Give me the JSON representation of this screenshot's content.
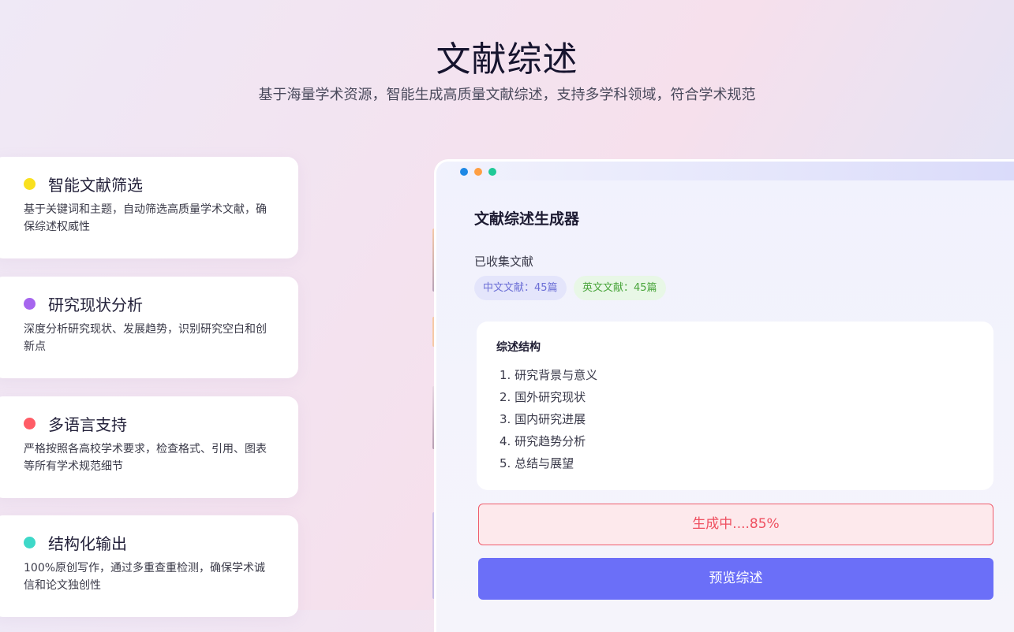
{
  "hero": {
    "title": "文献综述",
    "subtitle": "基于海量学术资源，智能生成高质量文献综述，支持多学科领域，符合学术规范"
  },
  "features": [
    {
      "title": "智能文献筛选",
      "desc": "基于关键词和主题，自动筛选高质量学术文献，确保综述权威性",
      "color": "#f9e01f"
    },
    {
      "title": "研究现状分析",
      "desc": "深度分析研究现状、发展趋势，识别研究空白和创新点",
      "color": "#a666ee"
    },
    {
      "title": "多语言支持",
      "desc": "严格按照各高校学术要求，检查格式、引用、图表等所有学术规范细节",
      "color": "#ff5c66"
    },
    {
      "title": "结构化输出",
      "desc": "100%原创写作，通过多重查重检测，确保学术诚信和论文独创性",
      "color": "#3ed8c8"
    }
  ],
  "app": {
    "title": "文献综述生成器",
    "collected_label": "已收集文献",
    "tags": {
      "chinese": "中文文献：45篇",
      "english": "英文文献：45篇"
    },
    "outline": {
      "title": "综述结构",
      "items": [
        "1. 研究背景与意义",
        "2. 国外研究现状",
        "3. 国内研究进展",
        "4. 研究趋势分析",
        "5. 总结与展望"
      ]
    },
    "progress": {
      "text": "生成中....85%",
      "value_percent": 85
    },
    "preview_button": "预览综述",
    "window_dot_colors": [
      "#1e88e5",
      "#ff9f43",
      "#20c997"
    ]
  }
}
